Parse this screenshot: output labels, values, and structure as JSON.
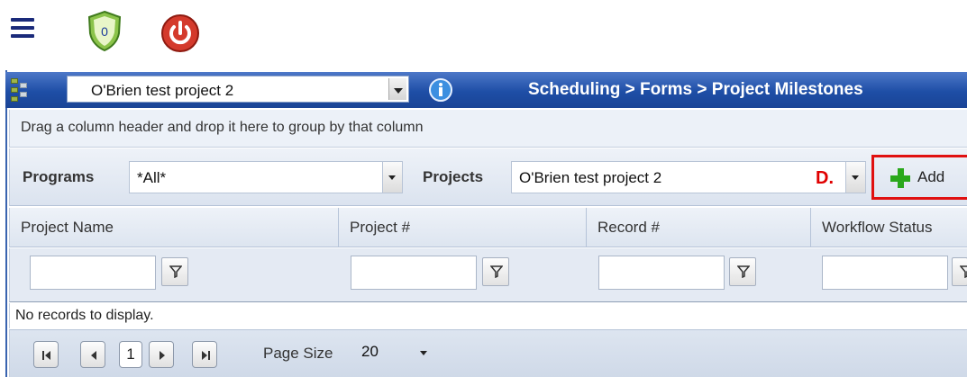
{
  "toolbar": {
    "menu_icon": "hamburger-menu-icon",
    "notifications_count": "0",
    "notifications_icon": "shield-badge-icon",
    "power_icon": "power-icon"
  },
  "header": {
    "project_select_value": "O'Brien test project 2",
    "info_icon": "info-icon",
    "breadcrumb": "Scheduling > Forms > Project Milestones"
  },
  "group_panel": {
    "hint": "Drag a column header and drop it here to group by that column"
  },
  "filters": {
    "programs_label": "Programs",
    "programs_value": "*All*",
    "projects_label": "Projects",
    "projects_value": "O'Brien test project 2",
    "annotation": "D.",
    "add_label": "Add"
  },
  "grid": {
    "columns": [
      "Project Name",
      "Project #",
      "Record #",
      "Workflow Status"
    ],
    "filter_icon": "funnel-filter-icon",
    "empty_message": "No records to display."
  },
  "pager": {
    "current_page": "1",
    "page_size_label": "Page Size",
    "page_size_value": "20"
  },
  "colors": {
    "header_blue": "#1e4ea6",
    "add_plus_green": "#2aa81c",
    "annotation_red": "#e00000"
  }
}
